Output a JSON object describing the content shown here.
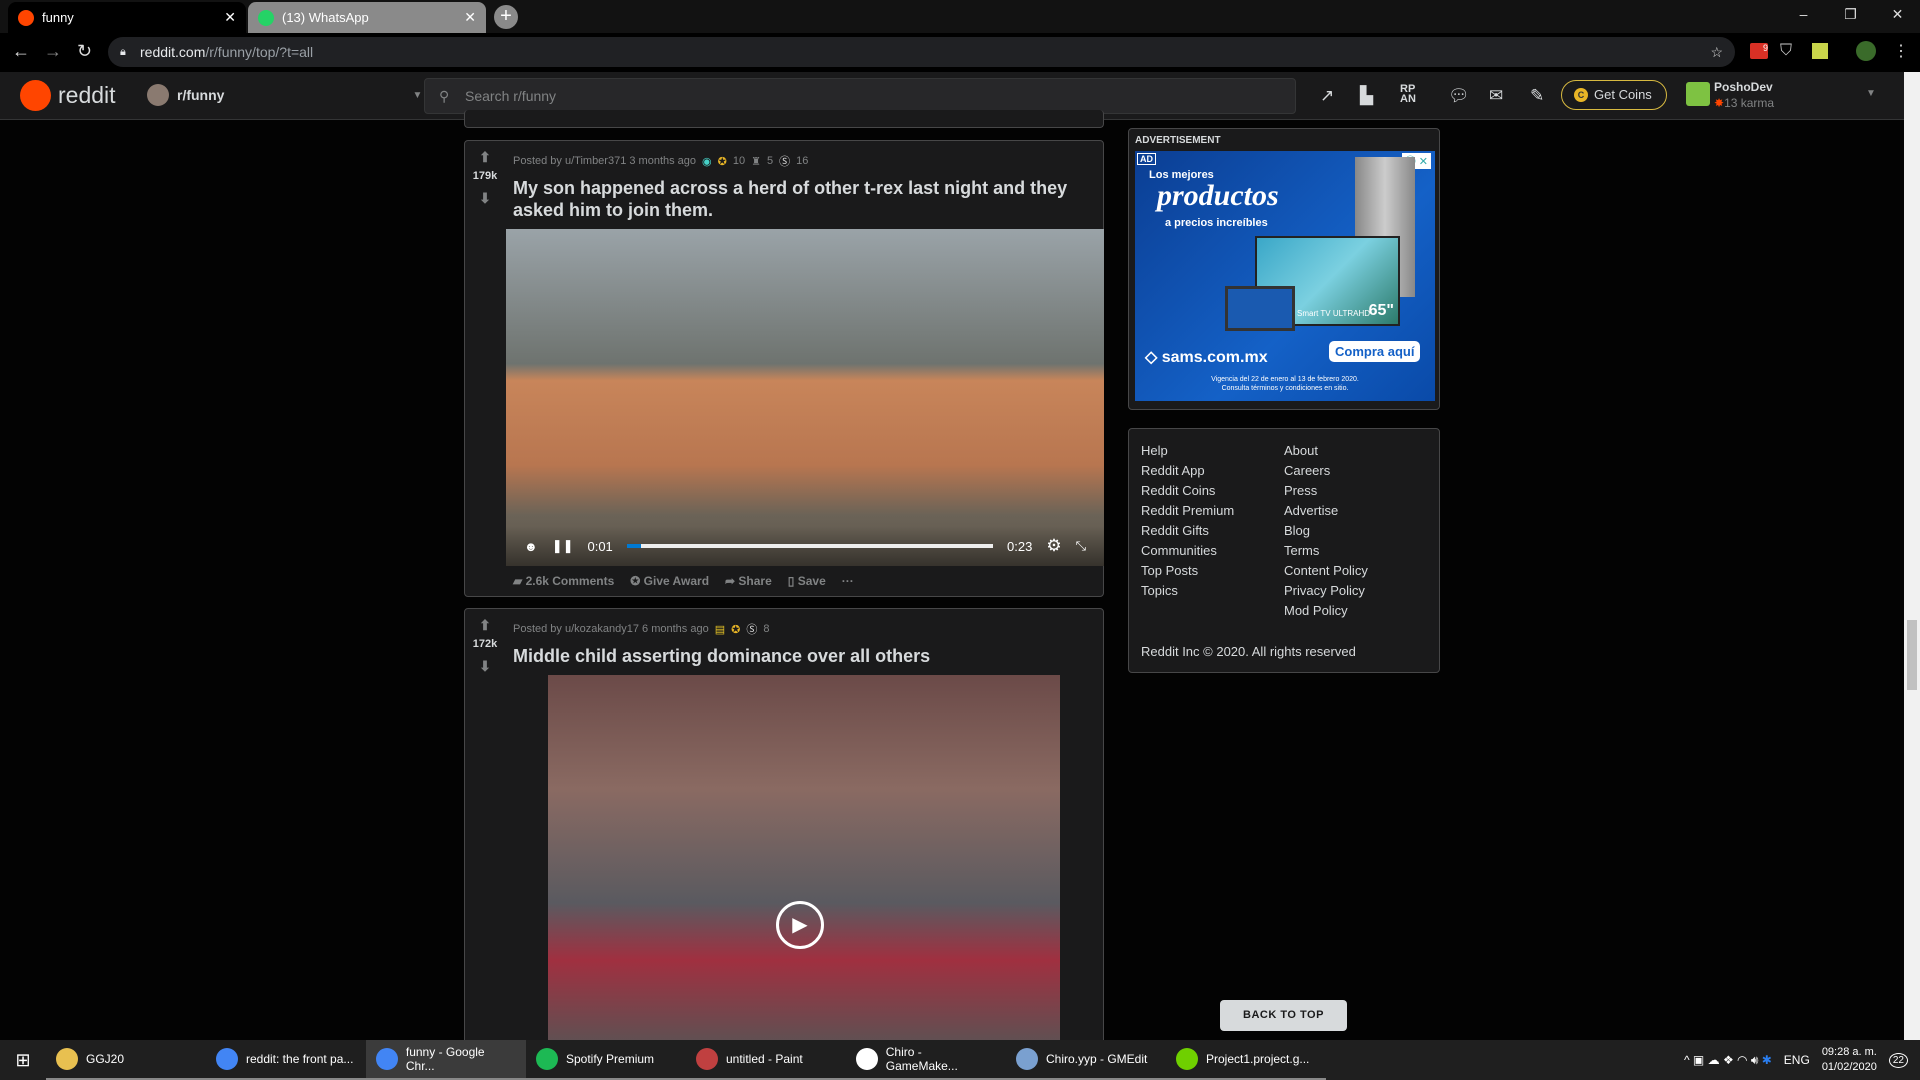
{
  "browser": {
    "tabs": [
      {
        "label": "funny",
        "active": true
      },
      {
        "label": "(13) WhatsApp",
        "active": false
      }
    ],
    "url_host": "reddit.com",
    "url_path": "/r/funny/top/?t=all",
    "ext_badge": "9"
  },
  "reddit": {
    "logo": "reddit",
    "subreddit": "r/funny",
    "search_placeholder": "Search r/funny",
    "get_coins": "Get Coins",
    "username": "PoshoDev",
    "karma": "13 karma"
  },
  "posts": [
    {
      "votes": "179k",
      "posted_by": "Posted by u/Timber371 3 months ago",
      "award_counts": [
        "10",
        "5",
        "16"
      ],
      "title": "My son happened across a herd of other t-rex last night and they asked him to join them.",
      "video": {
        "current": "0:01",
        "duration": "0:23",
        "progress": 0.04
      },
      "comments": "2.6k Comments",
      "give_award": "Give Award",
      "share": "Share",
      "save": "Save",
      "more": "···"
    },
    {
      "votes": "172k",
      "posted_by": "Posted by u/kozakandy17 6 months ago",
      "award_counts": [
        "8"
      ],
      "title": "Middle child asserting dominance over all others"
    }
  ],
  "ad": {
    "heading": "ADVERTISEMENT",
    "badge": "AD",
    "line1": "Los mejores",
    "line2": "productos",
    "line3": "a precios increíbles",
    "tv": "Smart TV ULTRAHD",
    "size": "65\"",
    "brand": "sams.com.mx",
    "cta": "Compra aquí",
    "fine1": "Vigencia del 22 de enero al 13 de febrero 2020.",
    "fine2": "Consulta términos y condiciones en sitio."
  },
  "footer": {
    "col1": [
      "Help",
      "Reddit App",
      "Reddit Coins",
      "Reddit Premium",
      "Reddit Gifts",
      "Communities",
      "Top Posts",
      "Topics"
    ],
    "col2": [
      "About",
      "Careers",
      "Press",
      "Advertise",
      "Blog",
      "Terms",
      "Content Policy",
      "Privacy Policy",
      "Mod Policy"
    ],
    "copyright": "Reddit Inc © 2020. All rights reserved"
  },
  "back_to_top": "BACK TO TOP",
  "taskbar": {
    "items": [
      "GGJ20",
      "reddit: the front pa...",
      "funny - Google Chr...",
      "Spotify Premium",
      "untitled - Paint",
      "Chiro - GameMake...",
      "Chiro.yyp - GMEdit",
      "Project1.project.g..."
    ],
    "lang": "ENG",
    "time": "09:28 a. m.",
    "date": "01/02/2020",
    "notifications": "22"
  }
}
